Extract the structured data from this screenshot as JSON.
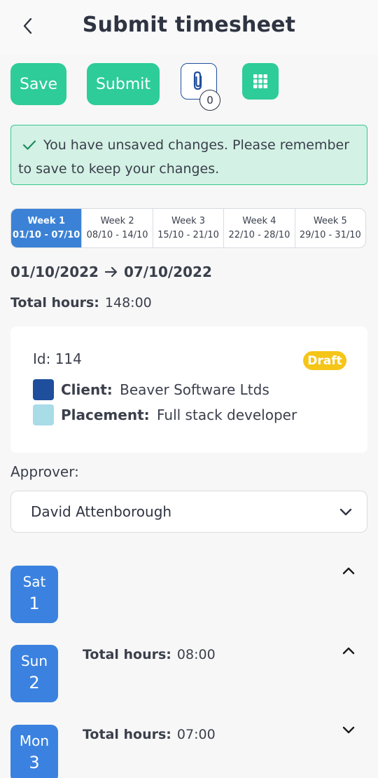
{
  "header": {
    "title": "Submit timesheet"
  },
  "toolbar": {
    "save_label": "Save",
    "submit_label": "Submit",
    "attachments_count": "0"
  },
  "alert": {
    "message": "You have unsaved changes. Please remember to save to keep your changes."
  },
  "weeks": [
    {
      "label": "Week 1",
      "range": "01/10 - 07/10",
      "active": true
    },
    {
      "label": "Week 2",
      "range": "08/10 - 14/10",
      "active": false
    },
    {
      "label": "Week 3",
      "range": "15/10 - 21/10",
      "active": false
    },
    {
      "label": "Week 4",
      "range": "22/10 - 28/10",
      "active": false
    },
    {
      "label": "Week 5",
      "range": "29/10 - 31/10",
      "active": false
    }
  ],
  "period": {
    "start": "01/10/2022",
    "end": "07/10/2022"
  },
  "summary": {
    "total_label": "Total hours:",
    "total_value": "148:00"
  },
  "timesheet": {
    "id_text": "Id: 114",
    "status": "Draft",
    "client_label": "Client:",
    "client_value": "Beaver Software Ltds",
    "placement_label": "Placement:",
    "placement_value": "Full stack developer"
  },
  "approver": {
    "label": "Approver:",
    "value": "David Attenborough"
  },
  "days": [
    {
      "name": "Sat",
      "number": "1",
      "hours_label": "",
      "hours_value": "",
      "expanded": true
    },
    {
      "name": "Sun",
      "number": "2",
      "hours_label": "Total hours:",
      "hours_value": "08:00",
      "expanded": true
    },
    {
      "name": "Mon",
      "number": "3",
      "hours_label": "Total hours:",
      "hours_value": "07:00",
      "expanded": false
    }
  ],
  "colors": {
    "primary_green": "#2ecc98",
    "primary_blue": "#3b82e0",
    "client_swatch": "#1f4e9c",
    "placement_swatch": "#a8dce6",
    "draft_badge": "#f5c518"
  }
}
